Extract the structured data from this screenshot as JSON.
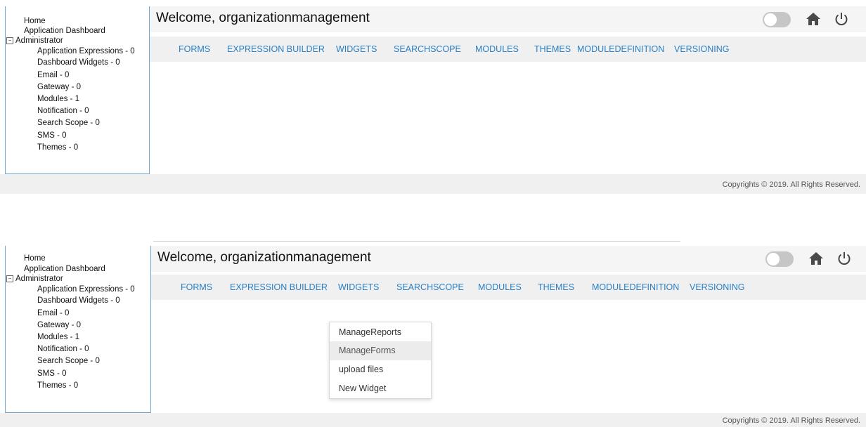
{
  "welcome_text": "Welcome, organizationmanagement",
  "sidebar": {
    "home": "Home",
    "dashboard": "Application Dashboard",
    "expand_symbol": "⊟",
    "admin": "Administrator",
    "children": [
      "Application Expressions - 0",
      "Dashboard Widgets - 0",
      "Email - 0",
      "Gateway - 0",
      "Modules - 1",
      "Notification - 0",
      "Search Scope - 0",
      "SMS - 0",
      "Themes - 0"
    ]
  },
  "nav": [
    "FORMS",
    "EXPRESSION BUILDER",
    "WIDGETS",
    "SEARCHSCOPE",
    "MODULES",
    "THEMES",
    "MODULEDEFINITION",
    "VERSIONING"
  ],
  "icons": {
    "toggle": "toggle-switch-icon",
    "home": "home-icon",
    "power": "power-icon"
  },
  "colors": {
    "nav_link": "#2a7fc4",
    "sidebar_border": "#6fa8d6",
    "bar_bg": "#f0f0f0"
  },
  "dropdown": {
    "items": [
      "ManageReports",
      "ManageForms",
      "upload files",
      "New Widget"
    ],
    "highlighted": "ManageForms"
  },
  "footer": "Copyrights © 2019. All Rights Reserved."
}
